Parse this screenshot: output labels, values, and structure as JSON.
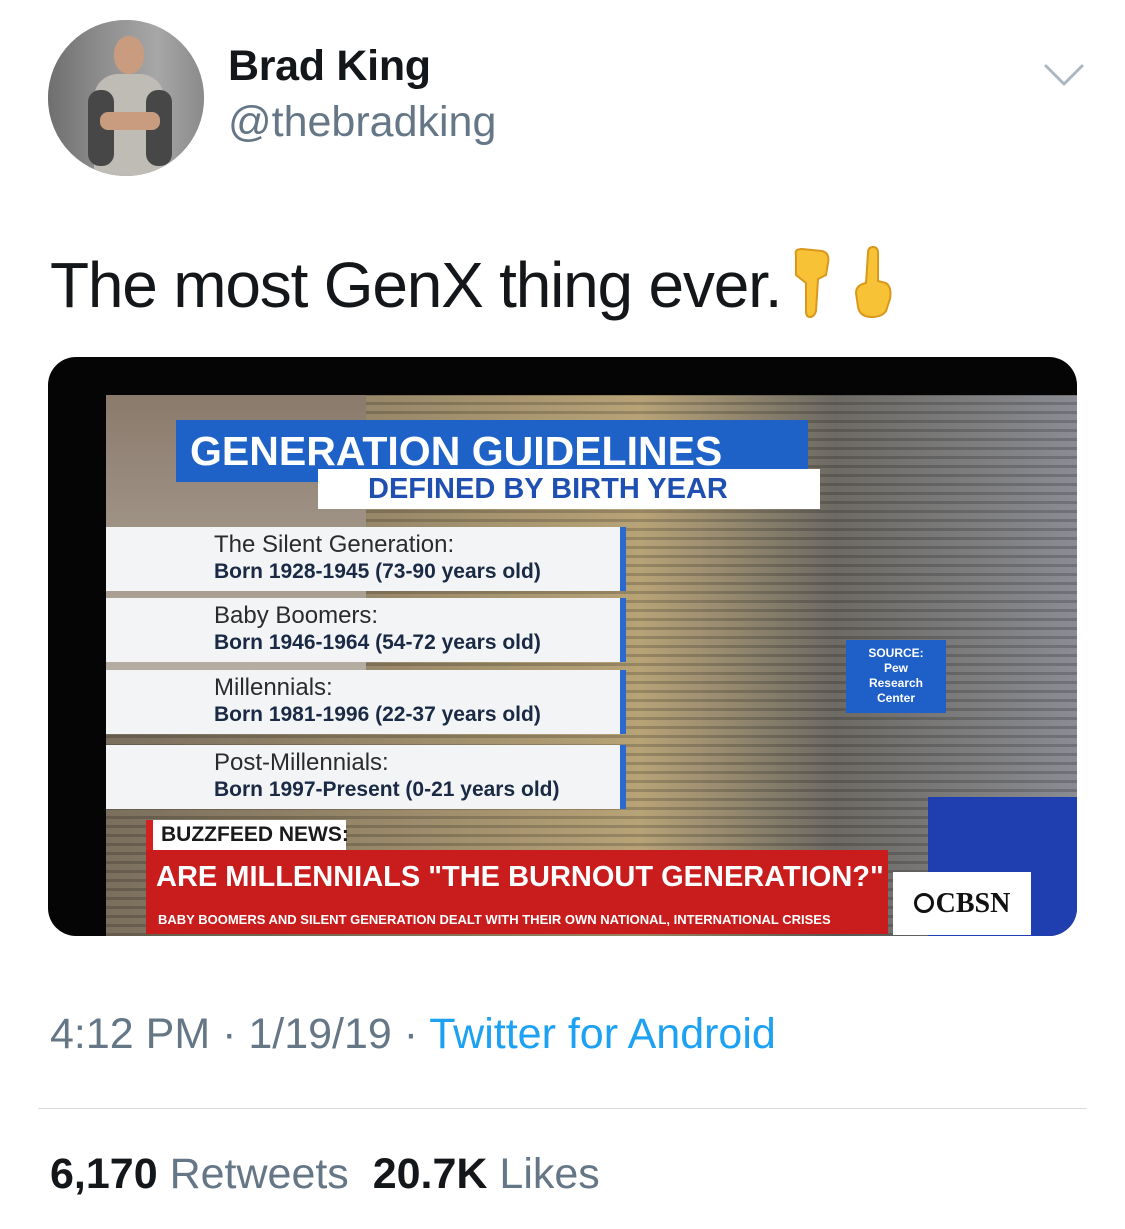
{
  "author": {
    "name": "Brad King",
    "handle": "@thebradking",
    "avatar_icon": "user-avatar-photo"
  },
  "tweet": {
    "text": "The most GenX thing ever.",
    "emojis": [
      "backhand-index-pointing-down-emoji",
      "backhand-index-pointing-up-emoji"
    ]
  },
  "media": {
    "title": "GENERATION GUIDELINES",
    "subtitle": "DEFINED BY BIRTH YEAR",
    "generations": [
      {
        "name": "The Silent Generation:",
        "born": "Born 1928-1945 (73-90 years old)"
      },
      {
        "name": "Baby Boomers:",
        "born": "Born 1946-1964 (54-72 years old)"
      },
      {
        "name": "Millennials:",
        "born": "Born 1981-1996 (22-37 years old)"
      },
      {
        "name": "Post-Millennials:",
        "born": "Born 1997-Present (0-21 years old)"
      }
    ],
    "source": {
      "line1": "SOURCE:",
      "line2": "Pew",
      "line3": "Research",
      "line4": "Center"
    },
    "tag": "BUZZFEED NEWS:",
    "headline": "ARE MILLENNIALS \"THE BURNOUT GENERATION?\"",
    "ticker": "BABY BOOMERS AND SILENT GENERATION DEALT WITH THEIR OWN NATIONAL, INTERNATIONAL CRISES",
    "network": "CBSN"
  },
  "meta": {
    "time": "4:12 PM",
    "sep1": " · ",
    "date": "1/19/19",
    "sep2": " · ",
    "source": "Twitter for Android"
  },
  "stats": {
    "retweets_count": "6,170",
    "retweets_label": "Retweets",
    "likes_count": "20.7K",
    "likes_label": "Likes"
  },
  "colors": {
    "link_blue": "#1da1f2",
    "secondary_gray": "#657786",
    "cbs_blue": "#1e62c8",
    "alert_red": "#c91d1d"
  }
}
